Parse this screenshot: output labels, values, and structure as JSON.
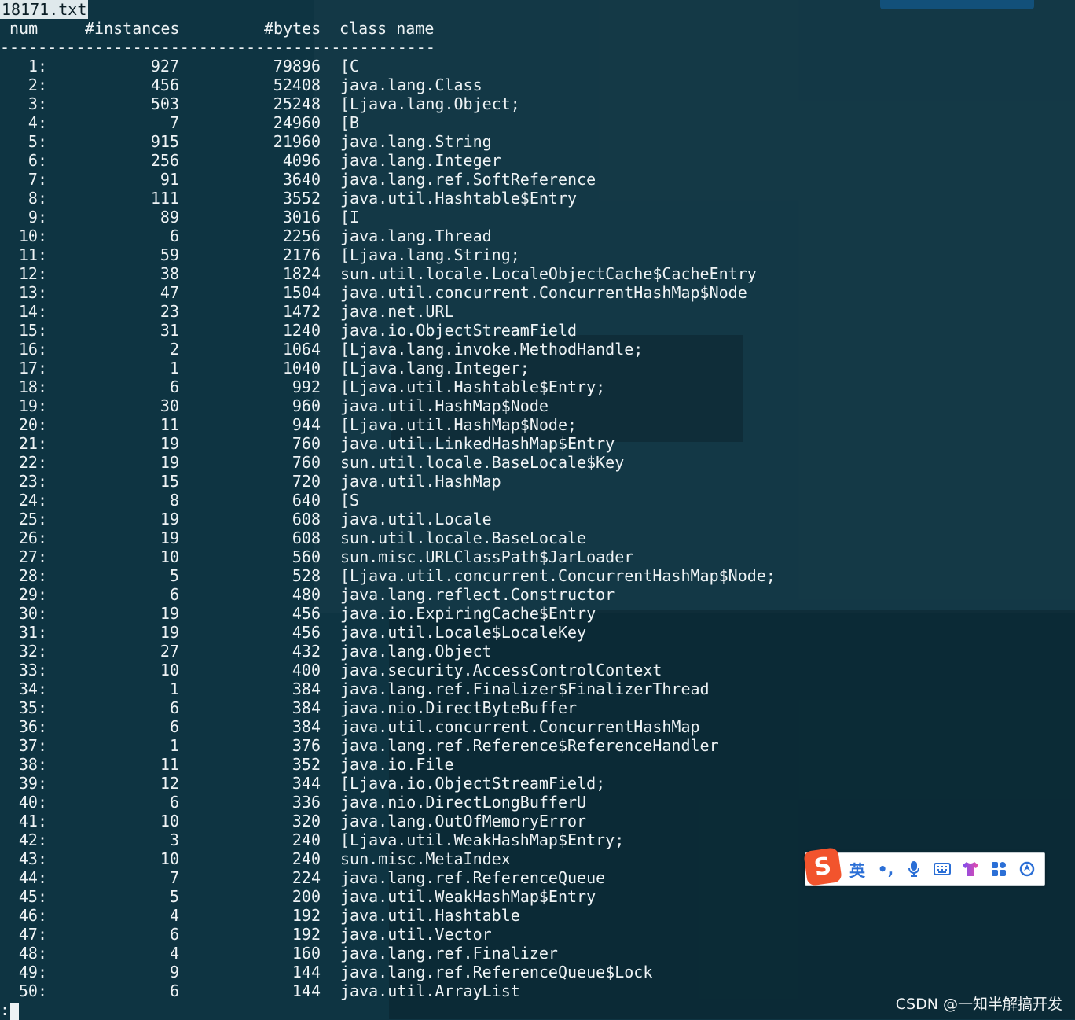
{
  "tab": {
    "title": "18171.txt"
  },
  "header": {
    "num": "num",
    "instances": "#instances",
    "bytes": "#bytes",
    "class_name": "class name"
  },
  "separator": "----------------------------------------------",
  "rows": [
    {
      "num": "1:",
      "instances": "927",
      "bytes": "79896",
      "class": "[C"
    },
    {
      "num": "2:",
      "instances": "456",
      "bytes": "52408",
      "class": "java.lang.Class"
    },
    {
      "num": "3:",
      "instances": "503",
      "bytes": "25248",
      "class": "[Ljava.lang.Object;"
    },
    {
      "num": "4:",
      "instances": "7",
      "bytes": "24960",
      "class": "[B"
    },
    {
      "num": "5:",
      "instances": "915",
      "bytes": "21960",
      "class": "java.lang.String"
    },
    {
      "num": "6:",
      "instances": "256",
      "bytes": "4096",
      "class": "java.lang.Integer"
    },
    {
      "num": "7:",
      "instances": "91",
      "bytes": "3640",
      "class": "java.lang.ref.SoftReference"
    },
    {
      "num": "8:",
      "instances": "111",
      "bytes": "3552",
      "class": "java.util.Hashtable$Entry"
    },
    {
      "num": "9:",
      "instances": "89",
      "bytes": "3016",
      "class": "[I"
    },
    {
      "num": "10:",
      "instances": "6",
      "bytes": "2256",
      "class": "java.lang.Thread"
    },
    {
      "num": "11:",
      "instances": "59",
      "bytes": "2176",
      "class": "[Ljava.lang.String;"
    },
    {
      "num": "12:",
      "instances": "38",
      "bytes": "1824",
      "class": "sun.util.locale.LocaleObjectCache$CacheEntry"
    },
    {
      "num": "13:",
      "instances": "47",
      "bytes": "1504",
      "class": "java.util.concurrent.ConcurrentHashMap$Node"
    },
    {
      "num": "14:",
      "instances": "23",
      "bytes": "1472",
      "class": "java.net.URL"
    },
    {
      "num": "15:",
      "instances": "31",
      "bytes": "1240",
      "class": "java.io.ObjectStreamField"
    },
    {
      "num": "16:",
      "instances": "2",
      "bytes": "1064",
      "class": "[Ljava.lang.invoke.MethodHandle;"
    },
    {
      "num": "17:",
      "instances": "1",
      "bytes": "1040",
      "class": "[Ljava.lang.Integer;"
    },
    {
      "num": "18:",
      "instances": "6",
      "bytes": "992",
      "class": "[Ljava.util.Hashtable$Entry;"
    },
    {
      "num": "19:",
      "instances": "30",
      "bytes": "960",
      "class": "java.util.HashMap$Node"
    },
    {
      "num": "20:",
      "instances": "11",
      "bytes": "944",
      "class": "[Ljava.util.HashMap$Node;"
    },
    {
      "num": "21:",
      "instances": "19",
      "bytes": "760",
      "class": "java.util.LinkedHashMap$Entry"
    },
    {
      "num": "22:",
      "instances": "19",
      "bytes": "760",
      "class": "sun.util.locale.BaseLocale$Key"
    },
    {
      "num": "23:",
      "instances": "15",
      "bytes": "720",
      "class": "java.util.HashMap"
    },
    {
      "num": "24:",
      "instances": "8",
      "bytes": "640",
      "class": "[S"
    },
    {
      "num": "25:",
      "instances": "19",
      "bytes": "608",
      "class": "java.util.Locale"
    },
    {
      "num": "26:",
      "instances": "19",
      "bytes": "608",
      "class": "sun.util.locale.BaseLocale"
    },
    {
      "num": "27:",
      "instances": "10",
      "bytes": "560",
      "class": "sun.misc.URLClassPath$JarLoader"
    },
    {
      "num": "28:",
      "instances": "5",
      "bytes": "528",
      "class": "[Ljava.util.concurrent.ConcurrentHashMap$Node;"
    },
    {
      "num": "29:",
      "instances": "6",
      "bytes": "480",
      "class": "java.lang.reflect.Constructor"
    },
    {
      "num": "30:",
      "instances": "19",
      "bytes": "456",
      "class": "java.io.ExpiringCache$Entry"
    },
    {
      "num": "31:",
      "instances": "19",
      "bytes": "456",
      "class": "java.util.Locale$LocaleKey"
    },
    {
      "num": "32:",
      "instances": "27",
      "bytes": "432",
      "class": "java.lang.Object"
    },
    {
      "num": "33:",
      "instances": "10",
      "bytes": "400",
      "class": "java.security.AccessControlContext"
    },
    {
      "num": "34:",
      "instances": "1",
      "bytes": "384",
      "class": "java.lang.ref.Finalizer$FinalizerThread"
    },
    {
      "num": "35:",
      "instances": "6",
      "bytes": "384",
      "class": "java.nio.DirectByteBuffer"
    },
    {
      "num": "36:",
      "instances": "6",
      "bytes": "384",
      "class": "java.util.concurrent.ConcurrentHashMap"
    },
    {
      "num": "37:",
      "instances": "1",
      "bytes": "376",
      "class": "java.lang.ref.Reference$ReferenceHandler"
    },
    {
      "num": "38:",
      "instances": "11",
      "bytes": "352",
      "class": "java.io.File"
    },
    {
      "num": "39:",
      "instances": "12",
      "bytes": "344",
      "class": "[Ljava.io.ObjectStreamField;"
    },
    {
      "num": "40:",
      "instances": "6",
      "bytes": "336",
      "class": "java.nio.DirectLongBufferU"
    },
    {
      "num": "41:",
      "instances": "10",
      "bytes": "320",
      "class": "java.lang.OutOfMemoryError"
    },
    {
      "num": "42:",
      "instances": "3",
      "bytes": "240",
      "class": "[Ljava.util.WeakHashMap$Entry;"
    },
    {
      "num": "43:",
      "instances": "10",
      "bytes": "240",
      "class": "sun.misc.MetaIndex"
    },
    {
      "num": "44:",
      "instances": "7",
      "bytes": "224",
      "class": "java.lang.ref.ReferenceQueue"
    },
    {
      "num": "45:",
      "instances": "5",
      "bytes": "200",
      "class": "java.util.WeakHashMap$Entry"
    },
    {
      "num": "46:",
      "instances": "4",
      "bytes": "192",
      "class": "java.util.Hashtable"
    },
    {
      "num": "47:",
      "instances": "6",
      "bytes": "192",
      "class": "java.util.Vector"
    },
    {
      "num": "48:",
      "instances": "4",
      "bytes": "160",
      "class": "java.lang.ref.Finalizer"
    },
    {
      "num": "49:",
      "instances": "9",
      "bytes": "144",
      "class": "java.lang.ref.ReferenceQueue$Lock"
    },
    {
      "num": "50:",
      "instances": "6",
      "bytes": "144",
      "class": "java.util.ArrayList"
    }
  ],
  "prompt": ":",
  "ime": {
    "logo": "S",
    "lang": "英",
    "punct": "•,"
  },
  "watermark": "CSDN @一知半解搞开发",
  "colors": {
    "background": "#0e3442",
    "text": "#eef3f5",
    "ime_accent": "#2b6fd6",
    "ime_logo": "#f2542d"
  }
}
